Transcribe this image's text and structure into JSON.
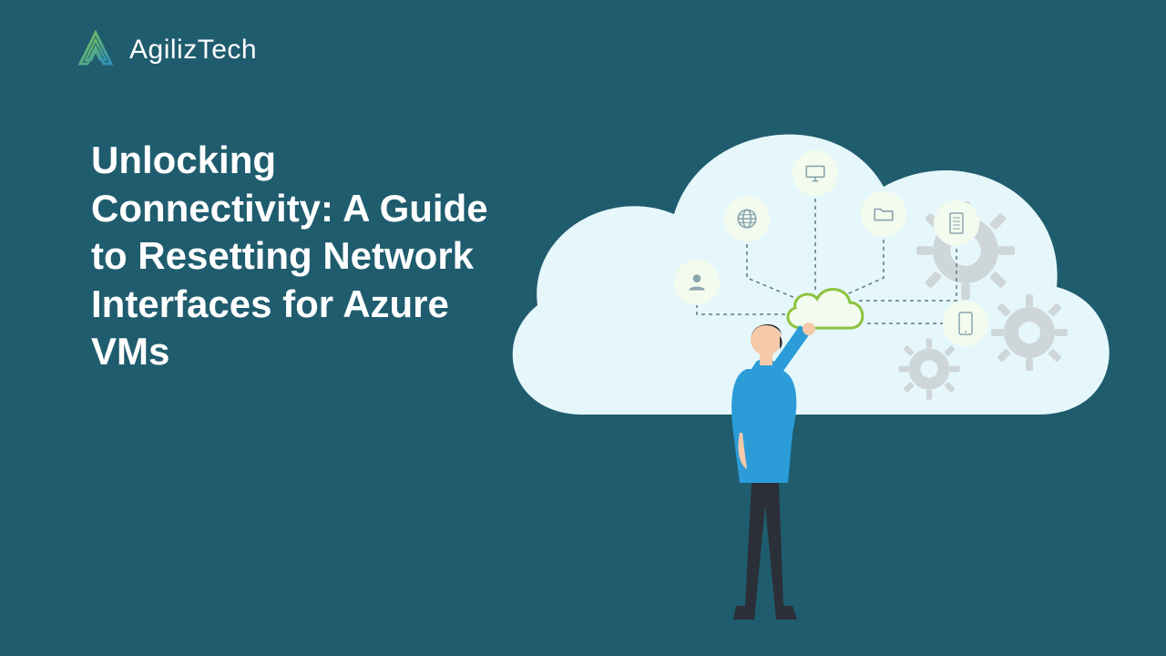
{
  "brand": {
    "name": "AgilizTech"
  },
  "headline": "Unlocking Connectivity: A Guide to Resetting Network Interfaces for Azure VMs",
  "colors": {
    "bg": "#1F5C6E",
    "cloud": "#E6F7FB",
    "accent": "#8CC340",
    "gear": "#C9D1D4",
    "icon_bg": "#F2FBED",
    "icon_fg": "#8AA5AE",
    "shirt": "#2B9CD8",
    "pants": "#2B2F38",
    "skin": "#F5C9A9",
    "hair": "#2B2F38"
  },
  "icons": [
    "person-icon",
    "globe-icon",
    "monitor-icon",
    "folder-icon",
    "server-icon",
    "phone-icon"
  ]
}
